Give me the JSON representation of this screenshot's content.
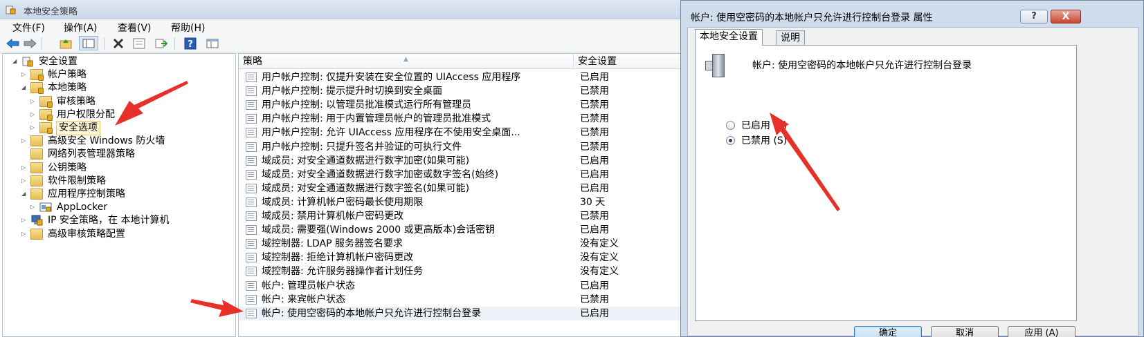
{
  "window": {
    "title": "本地安全策略",
    "minimize_label": ""
  },
  "menu": [
    "文件(F)",
    "操作(A)",
    "查看(V)",
    "帮助(H)"
  ],
  "toolbar": {
    "icons": [
      "back-icon",
      "forward-icon",
      "up-folder-icon",
      "show-hide-tree-icon",
      "delete-icon",
      "properties-icon",
      "export-list-icon",
      "help-icon",
      "console-icon"
    ],
    "help_glyph": "?"
  },
  "tree": [
    {
      "label": "安全设置",
      "level": 0,
      "expander": "open"
    },
    {
      "label": "帐户策略",
      "level": 1,
      "expander": "closed"
    },
    {
      "label": "本地策略",
      "level": 1,
      "expander": "open"
    },
    {
      "label": "审核策略",
      "level": 2,
      "expander": "closed"
    },
    {
      "label": "用户权限分配",
      "level": 2,
      "expander": "closed"
    },
    {
      "label": "安全选项",
      "level": 2,
      "expander": "closed",
      "selected": true
    },
    {
      "label": "高级安全 Windows 防火墙",
      "level": 1,
      "expander": "closed"
    },
    {
      "label": "网络列表管理器策略",
      "level": 1,
      "expander": "none"
    },
    {
      "label": "公钥策略",
      "level": 1,
      "expander": "closed"
    },
    {
      "label": "软件限制策略",
      "level": 1,
      "expander": "closed"
    },
    {
      "label": "应用程序控制策略",
      "level": 1,
      "expander": "open"
    },
    {
      "label": "AppLocker",
      "level": 2,
      "expander": "closed"
    },
    {
      "label": "IP 安全策略，在 本地计算机",
      "level": 1,
      "expander": "closed"
    },
    {
      "label": "高级审核策略配置",
      "level": 1,
      "expander": "closed"
    }
  ],
  "list": {
    "columns": {
      "policy": "策略",
      "setting": "安全设置"
    },
    "rows": [
      {
        "policy": "用户帐户控制: 仅提升安装在安全位置的 UIAccess 应用程序",
        "setting": "已启用"
      },
      {
        "policy": "用户帐户控制: 提示提升时切换到安全桌面",
        "setting": "已禁用"
      },
      {
        "policy": "用户帐户控制: 以管理员批准模式运行所有管理员",
        "setting": "已禁用"
      },
      {
        "policy": "用户帐户控制: 用于内置管理员帐户的管理员批准模式",
        "setting": "已禁用"
      },
      {
        "policy": "用户帐户控制: 允许 UIAccess 应用程序在不使用安全桌面...",
        "setting": "已禁用"
      },
      {
        "policy": "用户帐户控制: 只提升签名并验证的可执行文件",
        "setting": "已禁用"
      },
      {
        "policy": "域成员: 对安全通道数据进行数字加密(如果可能)",
        "setting": "已启用"
      },
      {
        "policy": "域成员: 对安全通道数据进行数字加密或数字签名(始终)",
        "setting": "已启用"
      },
      {
        "policy": "域成员: 对安全通道数据进行数字签名(如果可能)",
        "setting": "已启用"
      },
      {
        "policy": "域成员: 计算机帐户密码最长使用期限",
        "setting": "30 天"
      },
      {
        "policy": "域成员: 禁用计算机帐户密码更改",
        "setting": "已禁用"
      },
      {
        "policy": "域成员: 需要强(Windows 2000 或更高版本)会话密钥",
        "setting": "已启用"
      },
      {
        "policy": "域控制器: LDAP 服务器签名要求",
        "setting": "没有定义"
      },
      {
        "policy": "域控制器: 拒绝计算机帐户密码更改",
        "setting": "没有定义"
      },
      {
        "policy": "域控制器: 允许服务器操作者计划任务",
        "setting": "没有定义"
      },
      {
        "policy": "帐户: 管理员帐户状态",
        "setting": "已启用"
      },
      {
        "policy": "帐户: 来宾帐户状态",
        "setting": "已禁用"
      },
      {
        "policy": "帐户: 使用空密码的本地帐户只允许进行控制台登录",
        "setting": "已启用",
        "selected": true
      }
    ]
  },
  "dialog": {
    "title": "帐户: 使用空密码的本地帐户只允许进行控制台登录 属性",
    "help_label": "?",
    "close_label": "X",
    "tabs": [
      "本地安全设置",
      "说明"
    ],
    "heading": "帐户:  使用空密码的本地帐户只允许进行控制台登录",
    "options": [
      {
        "label": "已启用 (E)",
        "checked": false
      },
      {
        "label": "已禁用 (S)",
        "checked": true
      }
    ],
    "buttons": {
      "ok": "确定",
      "cancel": "取消",
      "apply": "应用 (A)"
    }
  },
  "annotation_color": "#e8302a"
}
